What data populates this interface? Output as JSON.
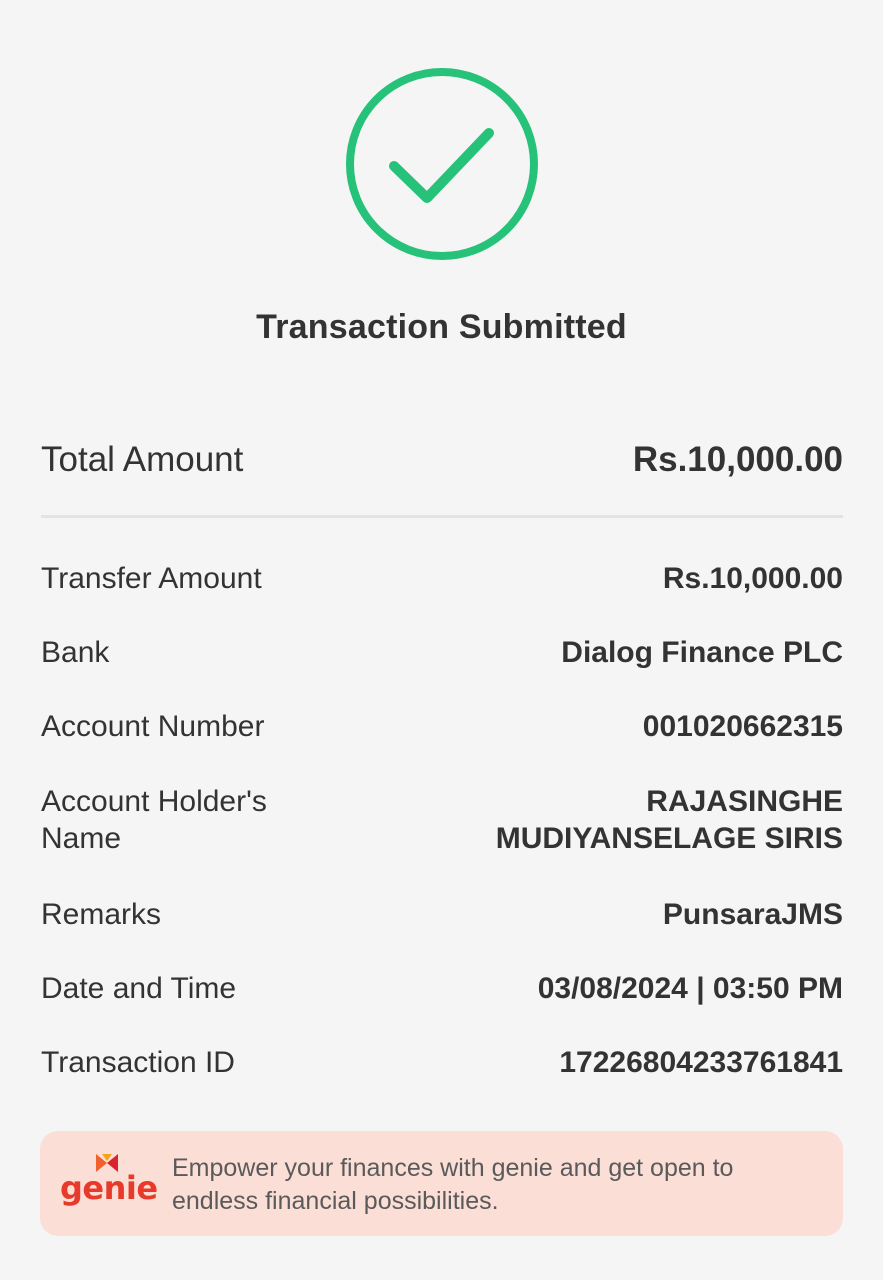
{
  "status": {
    "icon": "check-circle-icon",
    "color": "#27c27a",
    "title": "Transaction Submitted"
  },
  "summary": {
    "total_label": "Total Amount",
    "total_value": "Rs.10,000.00"
  },
  "details": [
    {
      "label": "Transfer Amount",
      "value": "Rs.10,000.00"
    },
    {
      "label": "Bank",
      "value": "Dialog Finance PLC"
    },
    {
      "label": "Account Number",
      "value": "001020662315"
    },
    {
      "label": "Account Holder's Name",
      "value": "RAJASINGHE MUDIYANSELAGE SIRIS"
    },
    {
      "label": "Remarks",
      "value": "PunsaraJMS"
    },
    {
      "label": "Date and Time",
      "value": "03/08/2024 | 03:50 PM"
    },
    {
      "label": "Transaction ID",
      "value": "17226804233761841"
    }
  ],
  "promo": {
    "logo_text": "genie",
    "logo_icon": "genie-logo-icon",
    "message": "Empower your finances with genie and get open to endless financial possibilities.",
    "accent_color": "#e83a2a",
    "background_color": "#fbded6"
  }
}
